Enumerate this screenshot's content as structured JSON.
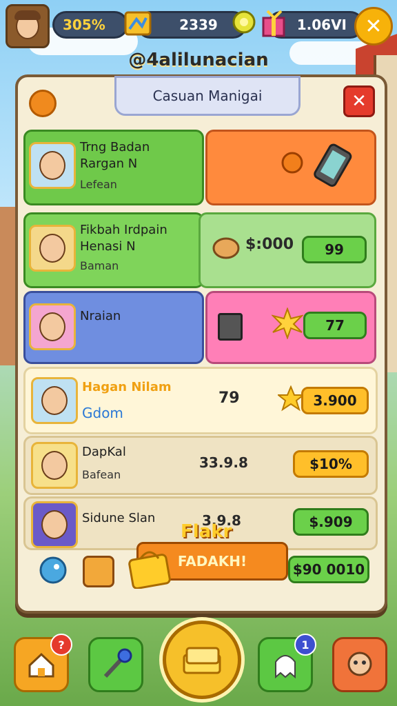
{
  "topbar": {
    "percent": "305%",
    "coins": "2339",
    "gems": "1.06VI",
    "close_symbol": "✕"
  },
  "subtitle": "@4alilunacian",
  "panel": {
    "title": "Casuan Manigai",
    "close_symbol": "✕",
    "rows": [
      {
        "name": "Trng Badan\nRargan N",
        "sub": "Lefean"
      },
      {
        "name": "Fikbah Irdpain\nHenasi N",
        "sub": "Baman",
        "price": "$:000",
        "button": "99"
      },
      {
        "name": "Nraian",
        "button": "77"
      },
      {
        "name": "Hagan Nilam",
        "sub": "Gdom",
        "value": "79",
        "button": "3.900"
      },
      {
        "name": "DapKal",
        "sub": "Bafean",
        "value": "33.9.8",
        "button": "$10%"
      },
      {
        "name": "Sidune Slan",
        "value": "3.9.8",
        "button": "$.909"
      },
      {
        "button": "$90 0010"
      }
    ]
  },
  "promo": {
    "title": "Flakr",
    "banner": "FADAKH!"
  },
  "nav": {
    "home_badge": "?",
    "quest_badge": "1"
  },
  "colors": {
    "row1_left": "#6fc94a",
    "row1_right": "#ff8a3d",
    "row2_left": "#7fd45a",
    "row2_right": "#a9e08f",
    "row3_left": "#6f8ee0",
    "row3_right": "#ff7fb7",
    "cream": "#fff6d8"
  }
}
